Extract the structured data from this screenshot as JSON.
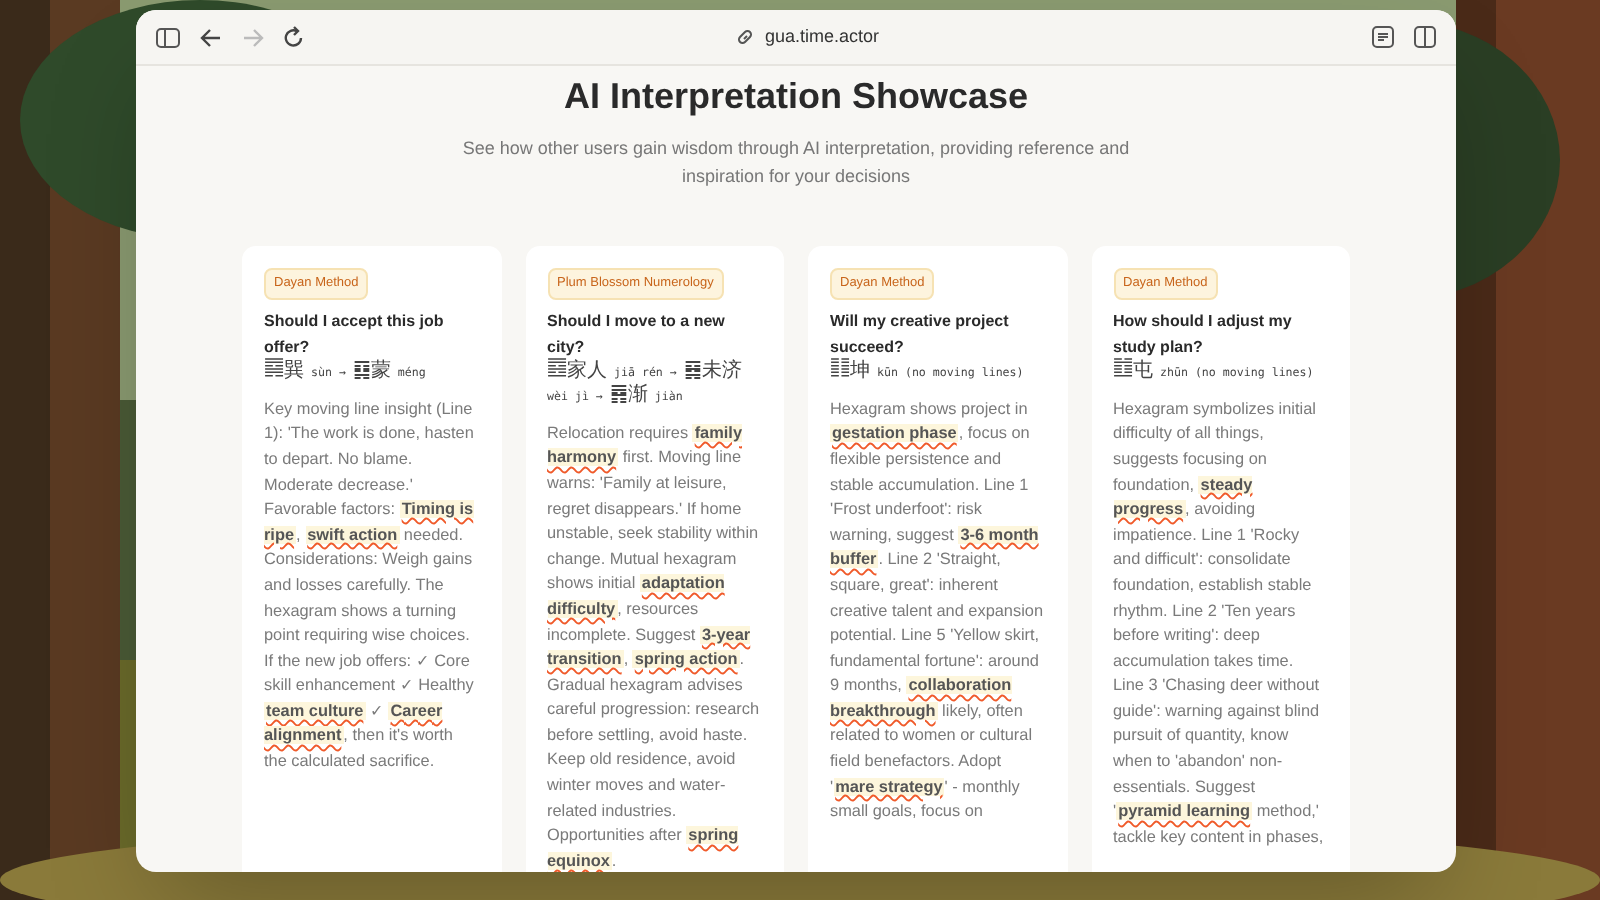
{
  "browser": {
    "url": "gua.time.actor",
    "forward_disabled": true
  },
  "page": {
    "title": "AI Interpretation Showcase",
    "subtitle": "See how other users gain wisdom through AI interpretation, providing reference and inspiration for your decisions"
  },
  "cards": [
    {
      "tag": "Dayan Method",
      "question": "Should I accept this job offer?",
      "hexagram": "䷸巽 sùn → ䷃蒙 méng",
      "body": [
        {
          "text": "Key moving line insight (Line 1): 'The work is done, hasten to depart. No blame. Moderate decrease.' Favorable factors: ",
          "highlight": false
        },
        {
          "text": "Timing is ripe",
          "highlight": true
        },
        {
          "text": ", ",
          "highlight": false
        },
        {
          "text": "swift action",
          "highlight": true
        },
        {
          "text": " needed. Considerations: Weigh gains and losses carefully. The hexagram shows a turning point requiring wise choices. If the new job offers: ✓ Core skill enhancement ✓ Healthy ",
          "highlight": false
        },
        {
          "text": "team culture",
          "highlight": true
        },
        {
          "text": " ✓ ",
          "highlight": false
        },
        {
          "text": "Career alignment",
          "highlight": true
        },
        {
          "text": ", then it's worth the calculated sacrifice.",
          "highlight": false
        }
      ]
    },
    {
      "tag": "Plum Blossom Numerology",
      "question": "Should I move to a new city?",
      "hexagram": "䷤家人 jiā rén → ䷿未济 wèi jì → ䷴渐 jiàn",
      "body": [
        {
          "text": "Relocation requires ",
          "highlight": false
        },
        {
          "text": "family harmony",
          "highlight": true
        },
        {
          "text": " first. Moving line warns: 'Family at leisure, regret disappears.' If home unstable, seek stability within change. Mutual hexagram shows initial ",
          "highlight": false
        },
        {
          "text": "adaptation difficulty",
          "highlight": true
        },
        {
          "text": ", resources incomplete. Suggest ",
          "highlight": false
        },
        {
          "text": "3-year transition",
          "highlight": true
        },
        {
          "text": ", ",
          "highlight": false
        },
        {
          "text": "spring action",
          "highlight": true
        },
        {
          "text": ". Gradual hexagram advises careful progression: research before settling, avoid haste. Keep old residence, avoid winter moves and water-related industries. Opportunities after ",
          "highlight": false
        },
        {
          "text": "spring equinox",
          "highlight": true
        },
        {
          "text": ".",
          "highlight": false
        }
      ]
    },
    {
      "tag": "Dayan Method",
      "question": "Will my creative project succeed?",
      "hexagram": "䷁坤 kūn (no moving lines)",
      "body": [
        {
          "text": "Hexagram shows project in ",
          "highlight": false
        },
        {
          "text": "gestation phase",
          "highlight": true
        },
        {
          "text": ", focus on flexible persistence and stable accumulation. Line 1 'Frost underfoot': risk warning, suggest ",
          "highlight": false
        },
        {
          "text": "3-6 month buffer",
          "highlight": true
        },
        {
          "text": ". Line 2 'Straight, square, great': inherent creative talent and expansion potential. Line 5 'Yellow skirt, fundamental fortune': around 9 months, ",
          "highlight": false
        },
        {
          "text": "collaboration breakthrough",
          "highlight": true
        },
        {
          "text": " likely, often related to women or cultural field benefactors. Adopt '",
          "highlight": false
        },
        {
          "text": "mare strategy",
          "highlight": true
        },
        {
          "text": "' - monthly small goals, focus on",
          "highlight": false
        }
      ]
    },
    {
      "tag": "Dayan Method",
      "question": "How should I adjust my study plan?",
      "hexagram": "䷂屯 zhūn (no moving lines)",
      "body": [
        {
          "text": "Hexagram symbolizes initial difficulty of all things, suggests focusing on foundation, ",
          "highlight": false
        },
        {
          "text": "steady progress",
          "highlight": true
        },
        {
          "text": ", avoiding impatience. Line 1 'Rocky and difficult': consolidate foundation, establish stable rhythm. Line 2 'Ten years before writing': deep accumulation takes time. Line 3 'Chasing deer without guide': warning against blind pursuit of quantity, know when to 'abandon' non-essentials. Suggest '",
          "highlight": false
        },
        {
          "text": "pyramid learning",
          "highlight": true
        },
        {
          "text": " method,' tackle key content in phases,",
          "highlight": false
        }
      ]
    }
  ]
}
